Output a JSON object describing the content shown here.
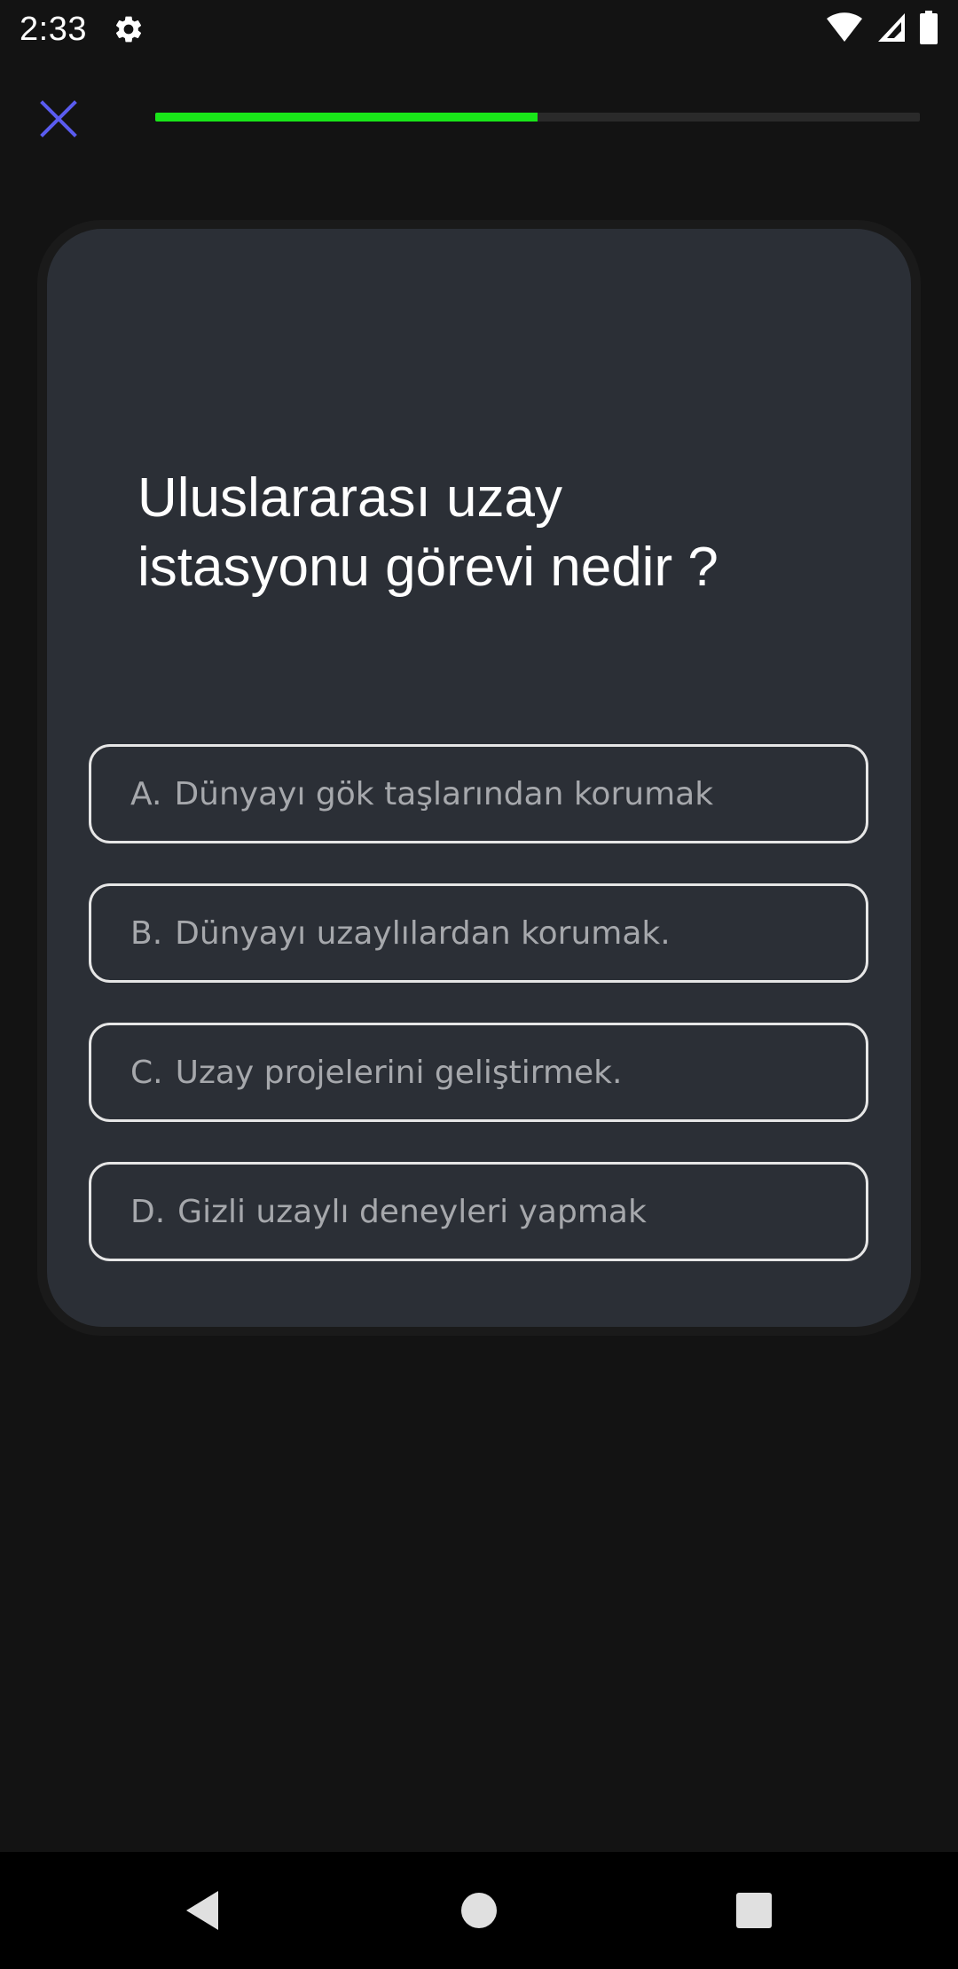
{
  "status_bar": {
    "time": "2:33",
    "icons": [
      "gear-icon",
      "wifi-icon",
      "signal-icon",
      "battery-icon"
    ]
  },
  "quiz": {
    "progress_fraction": 0.5,
    "progress_color": "#19e619",
    "close_color": "#5a5cf0",
    "question_line1": "Uluslararası uzay",
    "question_line2": "istasyonu görevi nedir ?",
    "options": [
      {
        "letter": "A.",
        "text": "Dünyayı gök taşlarından korumak"
      },
      {
        "letter": "B.",
        "text": "Dünyayı uzaylılardan korumak."
      },
      {
        "letter": "C.",
        "text": "Uzay projelerini geliştirmek."
      },
      {
        "letter": "D.",
        "text": "Gizli uzaylı deneyleri yapmak"
      }
    ]
  },
  "nav_bar": {
    "icons": [
      "back-icon",
      "home-icon",
      "recents-icon"
    ]
  }
}
